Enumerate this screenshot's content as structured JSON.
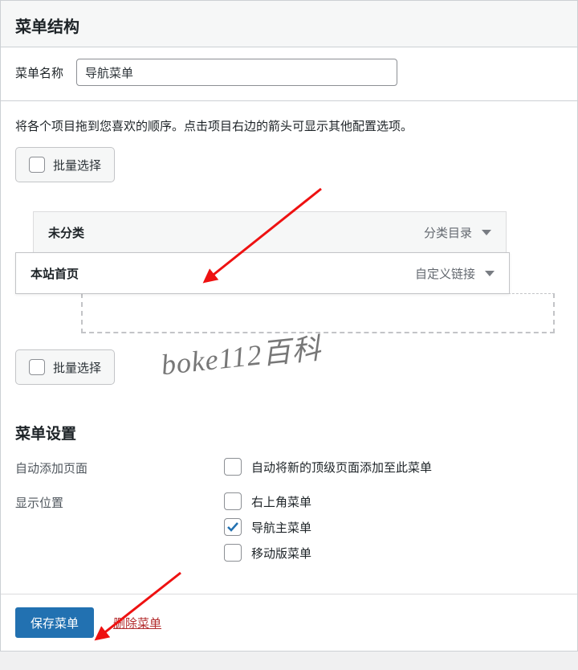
{
  "header": {
    "title": "菜单结构"
  },
  "nameRow": {
    "label": "菜单名称",
    "value": "导航菜单"
  },
  "helpText": "将各个项目拖到您喜欢的顺序。点击项目右边的箭头可显示其他配置选项。",
  "bulkSelectLabel": "批量选择",
  "menuItems": [
    {
      "title": "未分类",
      "type": "分类目录"
    },
    {
      "title": "本站首页",
      "type": "自定义链接"
    }
  ],
  "settings": {
    "title": "菜单设置",
    "autoAdd": {
      "label": "自动添加页面",
      "option": "自动将新的顶级页面添加至此菜单",
      "checked": false
    },
    "locations": {
      "label": "显示位置",
      "options": [
        {
          "label": "右上角菜单",
          "checked": false
        },
        {
          "label": "导航主菜单",
          "checked": true
        },
        {
          "label": "移动版菜单",
          "checked": false
        }
      ]
    }
  },
  "footer": {
    "save": "保存菜单",
    "delete": "删除菜单"
  },
  "watermark": "boke112百科"
}
